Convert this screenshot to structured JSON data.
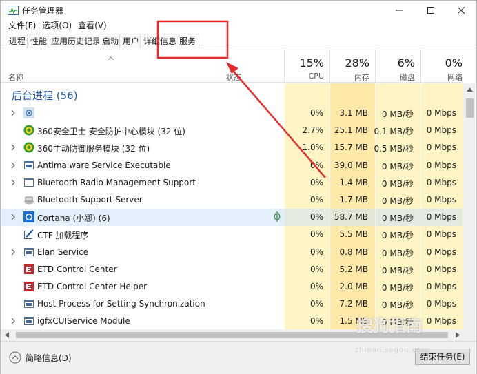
{
  "window": {
    "title": "任务管理器",
    "controls": [
      "minimize-icon",
      "maximize-icon",
      "close-icon"
    ]
  },
  "menu": [
    "文件(F)",
    "选项(O)",
    "查看(V)"
  ],
  "tabs": [
    "进程",
    "性能",
    "应用历史记录",
    "启动",
    "用户",
    "详细信息",
    "服务"
  ],
  "active_tab": "进程",
  "columns": {
    "name": "名称",
    "status": "状态",
    "cpu": {
      "percent": "15%",
      "label": "CPU"
    },
    "memory": {
      "percent": "28%",
      "label": "内存"
    },
    "disk": {
      "percent": "6%",
      "label": "磁盘"
    },
    "network": {
      "percent": "0%",
      "label": "网络"
    }
  },
  "group": {
    "label": "后台进程 (56)"
  },
  "rows": [
    {
      "name": "",
      "expandable": true,
      "icon": "gear-icon",
      "cpu": "0%",
      "mem": "3.1 MB",
      "disk": "0 MB/秒",
      "net": "0 Mbps"
    },
    {
      "name": "360安全卫士 安全防护中心模块 (32 位)",
      "expandable": false,
      "icon": "360-shield-icon",
      "cpu": "2.7%",
      "mem": "25.1 MB",
      "disk": "0.1 MB/秒",
      "net": "0 Mbps"
    },
    {
      "name": "360主动防御服务模块 (32 位)",
      "expandable": true,
      "icon": "360-shield-icon",
      "cpu": "1.0%",
      "mem": "15.7 MB",
      "disk": "0.5 MB/秒",
      "net": "0 Mbps"
    },
    {
      "name": "Antimalware Service Executable",
      "expandable": true,
      "icon": "service-window-icon",
      "cpu": "0%",
      "mem": "39.0 MB",
      "disk": "0 MB/秒",
      "net": "0 Mbps"
    },
    {
      "name": "Bluetooth Radio Management Support",
      "expandable": true,
      "icon": "window-frame-icon",
      "cpu": "0%",
      "mem": "1.4 MB",
      "disk": "0 MB/秒",
      "net": "0 Mbps"
    },
    {
      "name": "Bluetooth Support Server",
      "expandable": false,
      "icon": "bluetooth-server-icon",
      "cpu": "0%",
      "mem": "1.7 MB",
      "disk": "0 MB/秒",
      "net": "0 Mbps"
    },
    {
      "name": "Cortana (小娜) (6)",
      "expandable": true,
      "icon": "cortana-icon",
      "cpu": "0%",
      "mem": "58.7 MB",
      "disk": "0 MB/秒",
      "net": "0 Mbps",
      "selected": true,
      "leaf": true
    },
    {
      "name": "CTF 加载程序",
      "expandable": false,
      "icon": "ctf-pen-icon",
      "cpu": "0%",
      "mem": "5.5 MB",
      "disk": "0 MB/秒",
      "net": "0 Mbps"
    },
    {
      "name": "Elan Service",
      "expandable": true,
      "icon": "service-window-icon",
      "cpu": "0%",
      "mem": "0.8 MB",
      "disk": "0 MB/秒",
      "net": "0 Mbps"
    },
    {
      "name": "ETD Control Center",
      "expandable": false,
      "icon": "etd-icon",
      "cpu": "0%",
      "mem": "5.2 MB",
      "disk": "0 MB/秒",
      "net": "0 Mbps"
    },
    {
      "name": "ETD Control Center Helper",
      "expandable": false,
      "icon": "etd-icon",
      "cpu": "0%",
      "mem": "2.0 MB",
      "disk": "0 MB/秒",
      "net": "0 Mbps"
    },
    {
      "name": "Host Process for Setting Synchronization",
      "expandable": false,
      "icon": "service-window-icon",
      "cpu": "0%",
      "mem": "7.2 MB",
      "disk": "0 MB/秒",
      "net": "0 Mbps"
    },
    {
      "name": "igfxCUIService Module",
      "expandable": true,
      "icon": "service-window-icon",
      "cpu": "0%",
      "mem": "1.5 MB",
      "disk": "0 MB/秒",
      "net": "0 Mbps"
    }
  ],
  "footer": {
    "fewer_details": "简略信息(D)",
    "end_task": "结束任务(E)"
  },
  "watermark": {
    "text": "搜狗指南",
    "sub": "zhinan.sogou.com"
  },
  "colors": {
    "accent_blue": "#2158a6",
    "annotation_red": "#e52b2b",
    "cpu_tint": "#fff4c4",
    "mem_tint": "#ffe9a8",
    "selected_row": "#cce4f7"
  }
}
